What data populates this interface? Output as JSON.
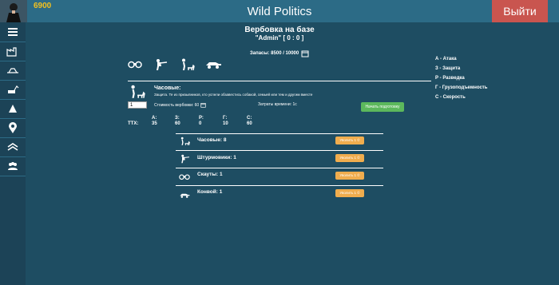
{
  "header": {
    "money": "6900",
    "title": "Wild Politics",
    "logout_label": "Выйти"
  },
  "sidebar": {
    "items": [
      {
        "icon": "menu-icon"
      },
      {
        "icon": "factory-icon"
      },
      {
        "icon": "field-icon"
      },
      {
        "icon": "digger-icon"
      },
      {
        "icon": "tank-icon"
      },
      {
        "icon": "location-icon"
      },
      {
        "icon": "rank-icon"
      },
      {
        "icon": "people-icon"
      }
    ]
  },
  "page": {
    "title": "Вербовка на базе",
    "player": "\"Admin\" [ 0 : 0 ]",
    "supplies": "Запасы: 8500 / 10000"
  },
  "legend": [
    "А - Атака",
    "З - Защита",
    "Р - Разведка",
    "Г - Грузоподъемность",
    "С - Скорость"
  ],
  "selected_unit": {
    "name": "Часовые:",
    "description": "Защита. Те из призывников, кто успели обзавестись собакой, семьей или тем и другим вместе",
    "quantity": "1",
    "cost": "Стоимость вербовки: 60",
    "time_cost": "Затраты времени: 1с",
    "start_label": "Начать подготовку"
  },
  "ttx": {
    "label": "ТТХ:",
    "columns": [
      {
        "key": "А:",
        "value": "35"
      },
      {
        "key": "З:",
        "value": "60"
      },
      {
        "key": "Р:",
        "value": "0"
      },
      {
        "key": "Г:",
        "value": "10"
      },
      {
        "key": "С:",
        "value": "60"
      }
    ]
  },
  "units": [
    {
      "label": "Часовые: 8",
      "button": "Уволить 1 ©"
    },
    {
      "label": "Штурмовики: 1",
      "button": "Уволить 1 ©"
    },
    {
      "label": "Скауты: 1",
      "button": "Уволить 1 ©"
    },
    {
      "label": "Конвой: 1",
      "button": "Уволить 1 ©"
    }
  ]
}
